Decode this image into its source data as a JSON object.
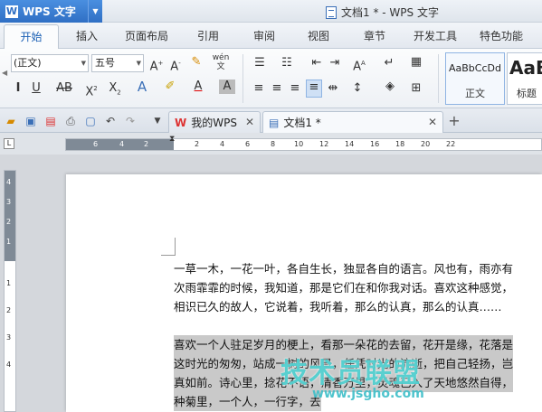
{
  "app": {
    "name": "WPS 文字",
    "logo": "W"
  },
  "window": {
    "document_title": "文档1 * - WPS 文字"
  },
  "menu": {
    "tabs": [
      "开始",
      "插入",
      "页面布局",
      "引用",
      "审阅",
      "视图",
      "章节",
      "开发工具",
      "特色功能"
    ]
  },
  "ribbon": {
    "font_name": "(正文)",
    "font_size": "五号",
    "styles": [
      {
        "sample": "AaBbCcDd",
        "name": "正文"
      },
      {
        "sample": "AaB",
        "name": "标题"
      }
    ]
  },
  "doc_tabs": [
    {
      "label": "我的WPS",
      "active": false
    },
    {
      "label": "文档1 *",
      "active": true
    }
  ],
  "ruler": {
    "h_marks": [
      "6",
      "4",
      "2",
      "2",
      "4",
      "6",
      "8",
      "10",
      "12",
      "14",
      "16",
      "18",
      "20",
      "22"
    ],
    "v_marks": [
      "4",
      "3",
      "2",
      "1",
      "1",
      "2",
      "3",
      "4"
    ]
  },
  "document": {
    "lines": [
      "一草一木，一花一叶，各自生长，独显各自的语言。风也有，雨亦有",
      "次雨霏霏的时候，我知道，那是它们在和你我对话。喜欢这种感觉，",
      "相识已久的故人，它说着，我听着，那么的认真，那么的认真……",
      "",
      "喜欢一个人驻足岁月的梗上，看那一朵花的去留，花开是缘，花落是",
      "这时光的匆匆，站成一树的风景，任凭时光的流逝，把自己轻扬，岂",
      "真如前。诗心里，捻花不语，清香万里，灵魂已入了天地悠然自得，",
      "种菊里，一个人，一行字，去"
    ],
    "highlight_from_line": 4
  },
  "watermark": {
    "text": "技术员联盟",
    "url": "www.jsgho.com"
  }
}
